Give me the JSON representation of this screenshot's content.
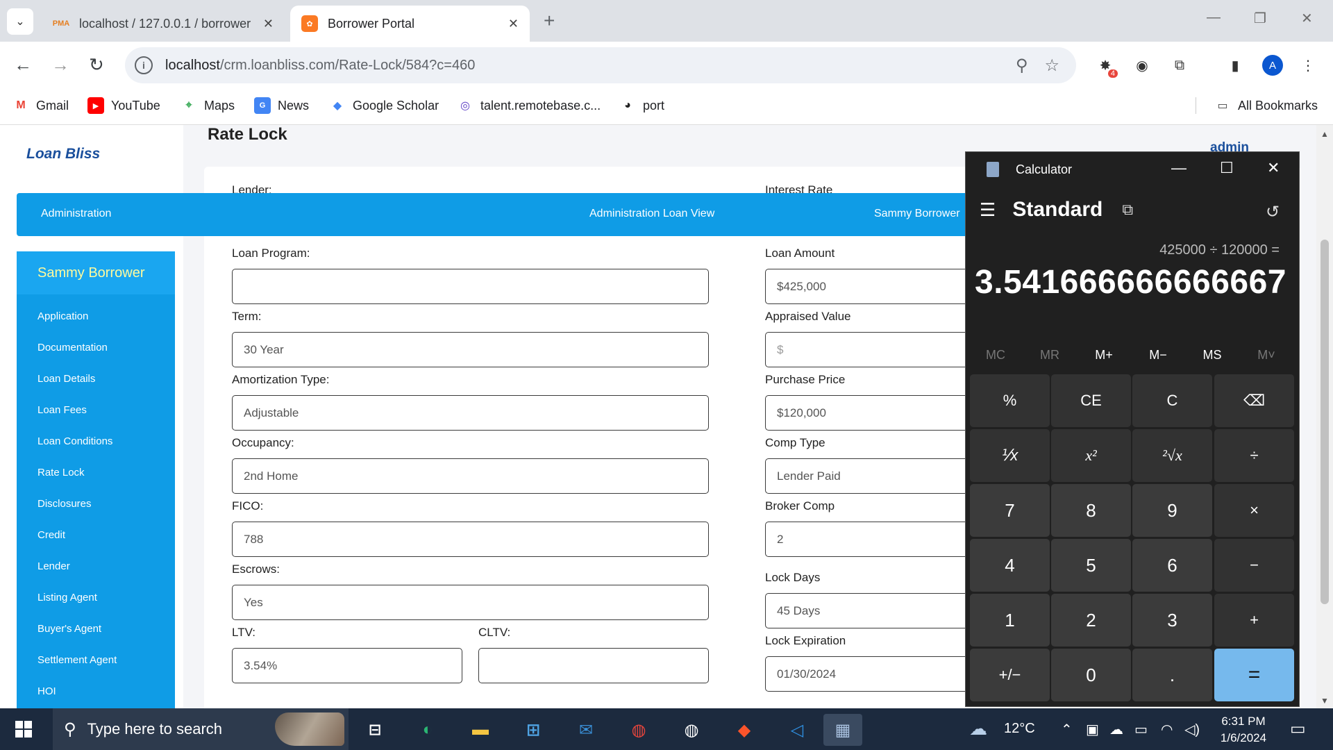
{
  "browser": {
    "tabs": [
      {
        "title": "localhost / 127.0.0.1 / borrower",
        "favicon": "PMA"
      },
      {
        "title": "Borrower Portal",
        "favicon": "XAMPP"
      }
    ],
    "url_host": "localhost",
    "url_path": "/crm.loanbliss.com/Rate-Lock/584?c=460",
    "extension_badge": "4",
    "profile_initial": "A",
    "bookmarks": [
      "Gmail",
      "YouTube",
      "Maps",
      "News",
      "Google Scholar",
      "talent.remotebase.c...",
      "port"
    ],
    "all_bookmarks": "All Bookmarks"
  },
  "app": {
    "brand": "Loan Bliss",
    "page_title": "Rate Lock",
    "user": "admin",
    "topnav": [
      "Administration",
      "Administration Loan View",
      "Sammy Borrower"
    ],
    "sidebar_header": "Sammy Borrower",
    "sidebar_items": [
      "Application",
      "Documentation",
      "Loan Details",
      "Loan Fees",
      "Loan Conditions",
      "Rate Lock",
      "Disclosures",
      "Credit",
      "Lender",
      "Listing Agent",
      "Buyer's Agent",
      "Settlement Agent",
      "HOI"
    ]
  },
  "form": {
    "lender_label": "Lender:",
    "interest_rate_label": "Interest Rate",
    "loan_program_label": "Loan Program:",
    "loan_program_value": "",
    "term_label": "Term:",
    "term_value": "30 Year",
    "amortization_label": "Amortization Type:",
    "amortization_value": "Adjustable",
    "occupancy_label": "Occupancy:",
    "occupancy_value": "2nd Home",
    "fico_label": "FICO:",
    "fico_value": "788",
    "escrows_label": "Escrows:",
    "escrows_value": "Yes",
    "ltv_label": "LTV:",
    "ltv_value": "3.54%",
    "cltv_label": "CLTV:",
    "cltv_value": "",
    "loan_amount_label": "Loan Amount",
    "loan_amount_value": "$425,000",
    "appraised_label": "Appraised Value",
    "appraised_placeholder": "$",
    "purchase_label": "Purchase Price",
    "purchase_value": "$120,000",
    "comp_type_label": "Comp Type",
    "comp_type_value": "Lender Paid",
    "broker_comp_label": "Broker Comp",
    "broker_comp_value": "2",
    "lock_days_label": "Lock Days",
    "lock_days_value": "45 Days",
    "lock_exp_label": "Lock Expiration",
    "lock_exp_value": "01/30/2024"
  },
  "calculator": {
    "title": "Calculator",
    "mode": "Standard",
    "expression": "425000 ÷ 120000 =",
    "result": "3.541666666666667",
    "memory": [
      "MC",
      "MR",
      "M+",
      "M−",
      "MS",
      "M˅"
    ],
    "keys": [
      "%",
      "CE",
      "C",
      "⌫",
      "⅟x",
      "x²",
      "²√x",
      "÷",
      "7",
      "8",
      "9",
      "×",
      "4",
      "5",
      "6",
      "−",
      "1",
      "2",
      "3",
      "+",
      "+/−",
      "0",
      ".",
      "="
    ]
  },
  "taskbar": {
    "search_placeholder": "Type here to search",
    "temperature": "12°C",
    "time": "6:31 PM",
    "date": "1/6/2024"
  }
}
